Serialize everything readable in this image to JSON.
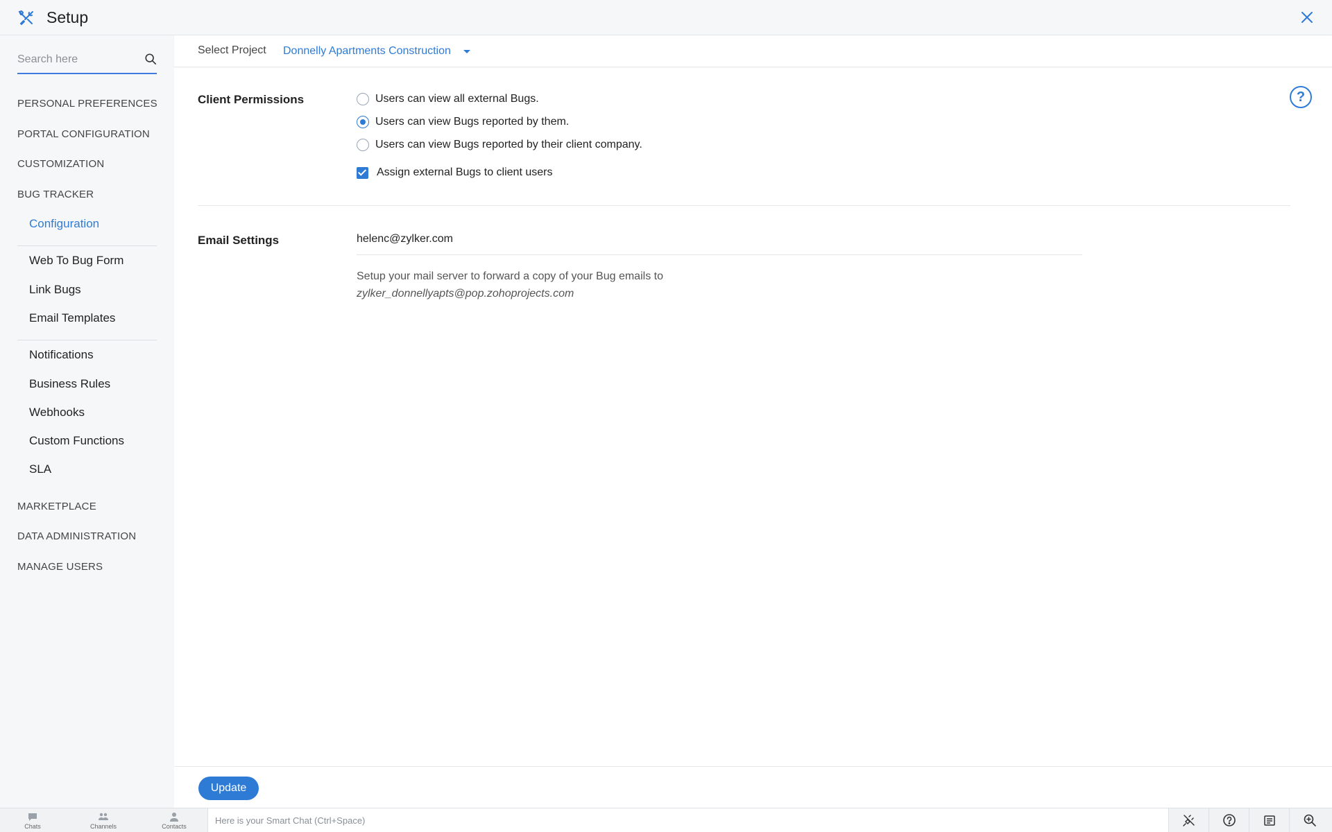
{
  "header": {
    "title": "Setup"
  },
  "sidebar": {
    "search_placeholder": "Search here",
    "sections": {
      "personal_preferences": "PERSONAL PREFERENCES",
      "portal_configuration": "PORTAL CONFIGURATION",
      "customization": "CUSTOMIZATION",
      "bug_tracker": "BUG TRACKER",
      "marketplace": "MARKETPLACE",
      "data_administration": "DATA ADMINISTRATION",
      "manage_users": "MANAGE USERS"
    },
    "bug_tracker_items": {
      "configuration": "Configuration",
      "web_to_bug_form": "Web To Bug Form",
      "link_bugs": "Link Bugs",
      "email_templates": "Email Templates",
      "notifications": "Notifications",
      "business_rules": "Business Rules",
      "webhooks": "Webhooks",
      "custom_functions": "Custom Functions",
      "sla": "SLA"
    }
  },
  "project_bar": {
    "label": "Select Project",
    "selected_project": "Donnelly Apartments Construction"
  },
  "client_permissions": {
    "title": "Client Permissions",
    "options": [
      {
        "label": "Users can view all external Bugs.",
        "selected": false
      },
      {
        "label": "Users can view Bugs reported by them.",
        "selected": true
      },
      {
        "label": "Users can view Bugs reported by their client company.",
        "selected": false
      }
    ],
    "assign_checkbox": {
      "label": "Assign external Bugs to client users",
      "checked": true
    }
  },
  "email_settings": {
    "title": "Email Settings",
    "email": "helenc@zylker.com",
    "note": "Setup your mail server to forward a copy of your Bug emails to",
    "forward_address": "zylker_donnellyapts@pop.zohoprojects.com"
  },
  "help": {
    "label": "?"
  },
  "footer": {
    "update_label": "Update"
  },
  "chatbar": {
    "tabs": {
      "chats": "Chats",
      "channels": "Channels",
      "contacts": "Contacts"
    },
    "input_placeholder": "Here is your Smart Chat (Ctrl+Space)"
  },
  "colors": {
    "accent": "#2e7bd6",
    "sidebar_bg": "#f6f7f8"
  }
}
